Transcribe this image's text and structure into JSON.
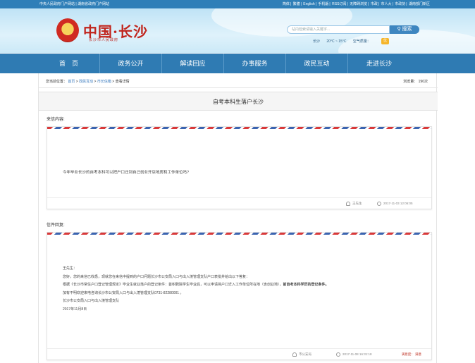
{
  "topbar": {
    "left": "中央人民政府门户网站 | 湖南省政府门户网站",
    "right_items": [
      "简体",
      "繁體",
      "English",
      "手机版",
      "RSS订阅",
      "无障碍浏览",
      "市政",
      "市人大",
      "市政协",
      "湖南部门新区"
    ]
  },
  "header": {
    "logo_title": "中国·长沙",
    "logo_subtitle": "长沙市人民政府",
    "search_placeholder": "站内检索请输入关键字...",
    "search_button": "搜索",
    "weather_city": "长沙",
    "weather_temp": "20°C ~ 15°C",
    "weather_air": "空气质量：",
    "weather_badge": "优"
  },
  "nav": {
    "items": [
      "首　页",
      "政务公开",
      "解读回应",
      "办事服务",
      "政民互动",
      "走进长沙"
    ]
  },
  "breadcrumb": {
    "prefix": "您当前位置：",
    "items": [
      "首页",
      "政民互动",
      "市长信箱",
      "查看详情"
    ],
    "views": "浏览量： 190次"
  },
  "page": {
    "title": "自考本科生落户长沙"
  },
  "question": {
    "label": "来信内容:",
    "text": "今年毕业长沙的自考本科可以把户口迁到自己创业开店地房和工作单位吗?",
    "author": "王先生",
    "date": "2017-11-03 12:06:05"
  },
  "reply": {
    "label": "信件回复:",
    "lines": [
      "王先生：",
      "您好，您的来信已收悉，现就您在来信中提到的户口问题长沙市公安局入口与出入境管理支队户口表批并给出以下答复：",
      "根据《长沙市常住户口登记管理规定》毕业生就业落户的登记条件：首积聘院学生毕业后，可以申请将户口迁入工作单位所在地（含创业地），",
      "加有不明欢迎来电咨询长沙市公安局入口与出入境管理支队0731-82280001 。",
      "长沙市公安局入口与出入境管理支队",
      "2017年11月8日"
    ],
    "emphasis": "前自考本科学历的登记条件。",
    "author": "市公安局",
    "date": "2017-11-08 16:31:18",
    "rating_label": "满意度：",
    "rating_value": "满意"
  }
}
